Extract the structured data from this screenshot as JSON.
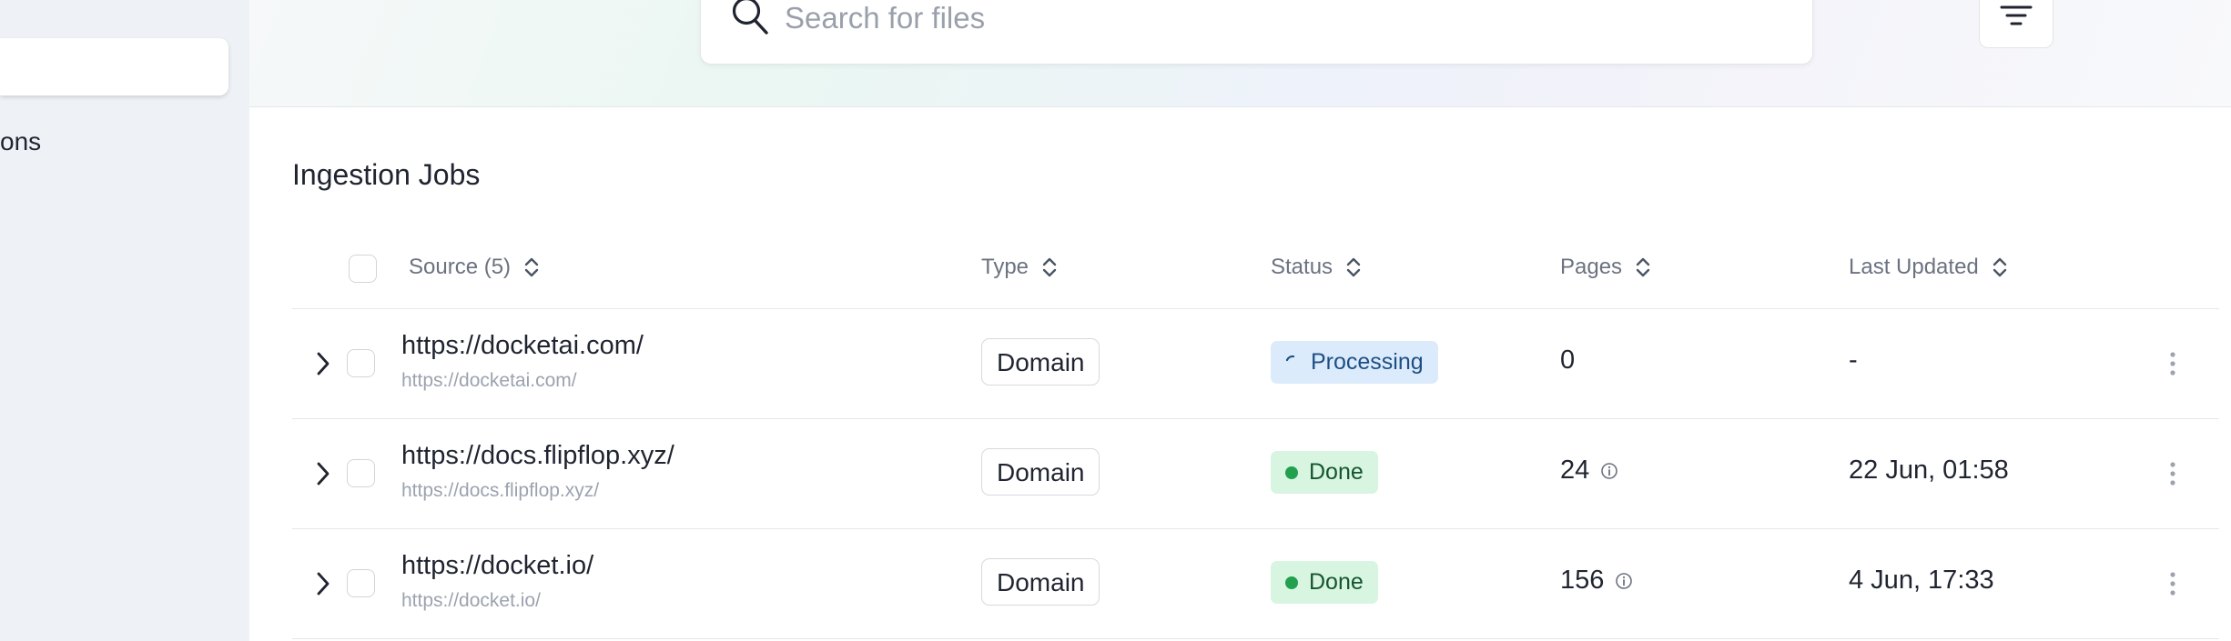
{
  "sidebar": {
    "partial_item_text": "ons"
  },
  "search": {
    "placeholder": "Search for files",
    "value": "",
    "icon": "search-icon",
    "filter_icon": "filter-icon"
  },
  "section": {
    "title": "Ingestion Jobs"
  },
  "table": {
    "columns": {
      "source": "Source (5)",
      "type": "Type",
      "status": "Status",
      "pages": "Pages",
      "last_updated": "Last Updated"
    },
    "rows": [
      {
        "source_title": "https://docketai.com/",
        "source_url": "https://docketai.com/",
        "type": "Domain",
        "status": "Processing",
        "pages": "0",
        "last_updated": "-"
      },
      {
        "source_title": "https://docs.flipflop.xyz/",
        "source_url": "https://docs.flipflop.xyz/",
        "type": "Domain",
        "status": "Done",
        "pages": "24",
        "last_updated": "22 Jun, 01:58"
      },
      {
        "source_title": "https://docket.io/",
        "source_url": "https://docket.io/",
        "type": "Domain",
        "status": "Done",
        "pages": "156",
        "last_updated": "4 Jun, 17:33"
      }
    ]
  },
  "colors": {
    "processing_bg": "#dcebfb",
    "processing_text": "#1d4f86",
    "done_bg": "#d7f5e1",
    "done_text": "#15552f",
    "done_dot": "#22a04e",
    "sidebar_bg": "#eef2f6"
  }
}
